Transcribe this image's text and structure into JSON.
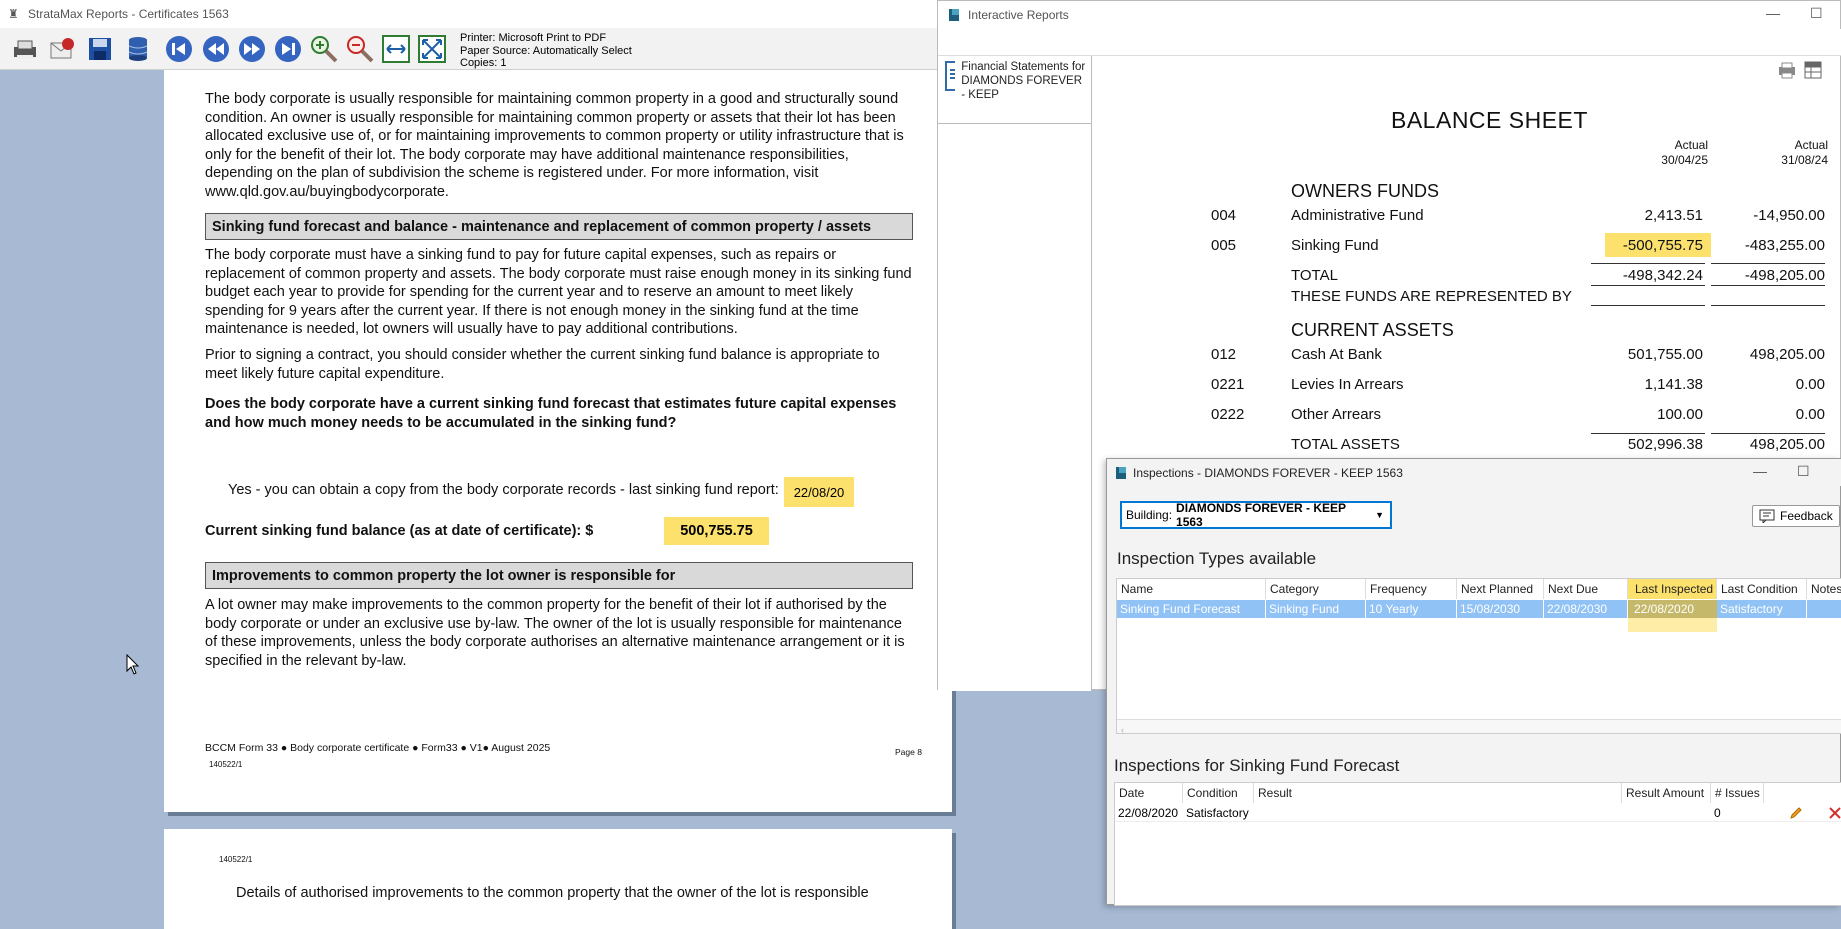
{
  "stratamax": {
    "title": "StrataMax Reports - Certificates 1563",
    "printer": {
      "printer": "Printer: Microsoft Print to PDF",
      "source": "Paper Source: Automatically Select",
      "copies": "Copies: 1"
    },
    "toolbar": {
      "print_icon": "printer-icon",
      "email_icon": "email-icon",
      "save_icon": "save-icon",
      "db_icon": "database-icon",
      "first_icon": "first-page-icon",
      "prev_icon": "previous-page-icon",
      "next_icon": "next-page-icon",
      "last_icon": "last-page-icon",
      "zoomin_icon": "zoom-in-icon",
      "zoomout_icon": "zoom-out-icon",
      "fitwidth_icon": "fit-width-icon",
      "fitpage_icon": "fit-page-icon"
    },
    "page": {
      "para1": "The body corporate is usually responsible for maintaining common property in a good and structurally sound condition. An owner is usually responsible for maintaining common property or assets that their lot has been allocated exclusive use of, or for maintaining improvements to common property or utility infrastructure that is only for the benefit of their lot. The body corporate may have additional maintenance responsibilities, depending on the plan of subdivision the scheme is registered under. For more information, visit www.qld.gov.au/buyingbodycorporate.",
      "section1": "Sinking fund forecast and balance - maintenance and replacement of common property / assets",
      "para2": "The body corporate must have a sinking fund to pay for future capital expenses, such as repairs or replacement of common property and assets. The body corporate must raise enough money in its sinking fund budget each year to provide for spending for the current year and to reserve an amount to meet likely spending for 9 years after the current year. If there is not enough money in the sinking fund at the time maintenance is needed, lot owners will usually have to pay additional contributions.",
      "para3": "Prior to signing a contract, you should consider whether the current sinking fund balance is appropriate to meet likely future capital expenditure.",
      "question": "Does the body corporate have a current sinking fund forecast that estimates future capital expenses and how much money needs to be accumulated in the sinking fund?",
      "answer": "Yes - you can obtain a copy from the body corporate records - last sinking fund report:",
      "report_date": "22/08/20",
      "balance_label": "Current sinking fund balance (as at date of certificate): $",
      "balance_value": "500,755.75",
      "section2": "Improvements to common property the lot owner is responsible for",
      "para4": "A lot owner may make improvements to the common property for the benefit of their lot if authorised by the body corporate or under an exclusive use by-law. The owner of the lot is usually responsible for maintenance of these improvements, unless the body corporate authorises an alternative maintenance arrangement or it is specified in the relevant by-law.",
      "footer_a": "BCCM Form 33",
      "footer_b": "Body corporate certificate",
      "footer_c": "Form33",
      "footer_d": "V1",
      "footer_e": "August 2025",
      "footer_code": "140522/1",
      "page_num": "Page 8"
    },
    "page2": {
      "code": "140522/1",
      "text": "Details of authorised improvements to the common property that the owner of the lot is responsible"
    }
  },
  "interactive_reports": {
    "title": "Interactive Reports",
    "report_item": "Financial Statements for DIAMONDS FOREVER - KEEP",
    "balance_sheet": {
      "title": "BALANCE SHEET",
      "col1_a": "Actual",
      "col1_b": "30/04/25",
      "col2_a": "Actual",
      "col2_b": "31/08/24",
      "owners_funds": "OWNERS FUNDS",
      "rows": [
        {
          "code": "004",
          "name": "Administrative Fund",
          "v1": "2,413.51",
          "v2": "-14,950.00"
        },
        {
          "code": "005",
          "name": "Sinking Fund",
          "v1": "-500,755.75",
          "v2": "-483,255.00"
        }
      ],
      "total_label": "TOTAL",
      "total_v1": "-498,342.24",
      "total_v2": "-498,205.00",
      "represented": "THESE FUNDS ARE REPRESENTED BY",
      "current_assets": "CURRENT ASSETS",
      "asset_rows": [
        {
          "code": "012",
          "name": "Cash At Bank",
          "v1": "501,755.00",
          "v2": "498,205.00"
        },
        {
          "code": "0221",
          "name": "Levies In Arrears",
          "v1": "1,141.38",
          "v2": "0.00"
        },
        {
          "code": "0222",
          "name": "Other Arrears",
          "v1": "100.00",
          "v2": "0.00"
        }
      ],
      "total_assets": "TOTAL ASSETS",
      "total_assets_v1": "502,996.38",
      "total_assets_v2": "498,205.00"
    }
  },
  "inspections": {
    "title": "Inspections - DIAMONDS FOREVER - KEEP 1563",
    "building_label": "Building:",
    "building_value": "DIAMONDS FOREVER - KEEP  1563",
    "feedback": "Feedback",
    "types_heading": "Inspection Types available",
    "types_columns": [
      "Name",
      "Category",
      "Frequency",
      "Next Planned",
      "Next Due",
      "Last Inspected",
      "Last Condition",
      "Notes"
    ],
    "types_row": [
      "Sinking Fund Forecast",
      "Sinking Fund",
      "10 Yearly",
      "15/08/2030",
      "22/08/2030",
      "22/08/2020",
      "Satisfactory",
      ""
    ],
    "for_heading": "Inspections for Sinking Fund Forecast",
    "for_columns": [
      "Date",
      "Condition",
      "Result",
      "Result Amount",
      "# Issues"
    ],
    "for_row": [
      "22/08/2020",
      "Satisfactory",
      "",
      "",
      "0"
    ],
    "highlight": "#fde16d",
    "selection": "#91c2f5"
  }
}
